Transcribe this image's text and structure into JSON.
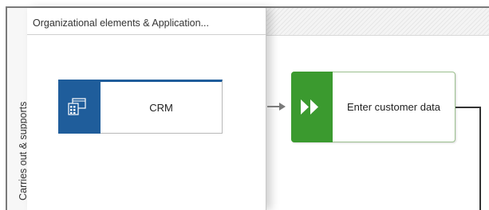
{
  "lane": {
    "header_label": "Organizational elements & Application..."
  },
  "row": {
    "header_label": "Carries out & supports"
  },
  "nodes": {
    "crm": {
      "label": "CRM",
      "icon": "application-icon",
      "color": "#1f5d9b"
    },
    "function": {
      "label": "Enter customer data",
      "icon": "fast-forward-icon",
      "color": "#3b9a2f"
    }
  },
  "colors": {
    "frame": "#7a7a7a",
    "connector": "#7a7a7a",
    "line": "#333333"
  }
}
